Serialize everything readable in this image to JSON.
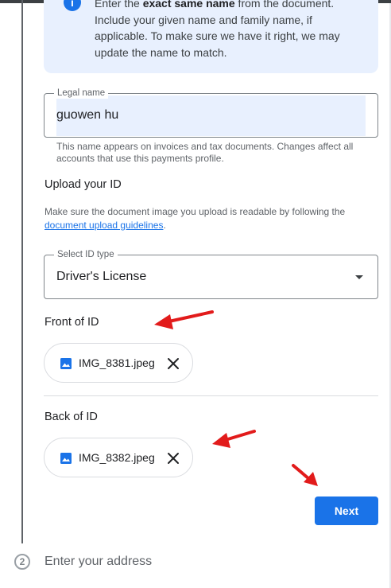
{
  "info": {
    "icon": "info-icon",
    "line1_pre": "Enter the ",
    "line1_bold": "exact same name",
    "line1_post": " from the document.",
    "rest": "Include your given name and family name, if applicable. To make sure we have it right, we may update the name to match."
  },
  "legal_name": {
    "label": "Legal name",
    "value": "guowen hu",
    "helper": "This name appears on invoices and tax documents. Changes affect all accounts that use this payments profile."
  },
  "upload": {
    "title": "Upload your ID",
    "guide_pre": "Make sure the document image you upload is readable by following the ",
    "guide_link": "document upload guidelines",
    "guide_post": "."
  },
  "id_type": {
    "label": "Select ID type",
    "value": "Driver's License",
    "icon": "dropdown-arrow-icon"
  },
  "front": {
    "title": "Front of ID",
    "file": "IMG_8381.jpeg"
  },
  "back": {
    "title": "Back of ID",
    "file": "IMG_8382.jpeg"
  },
  "next_label": "Next",
  "step2": {
    "number": "2",
    "title": "Enter your address"
  },
  "colors": {
    "accent": "#1a73e8",
    "annotation": "#e21b1b",
    "info_bg": "#e8f0fe"
  }
}
